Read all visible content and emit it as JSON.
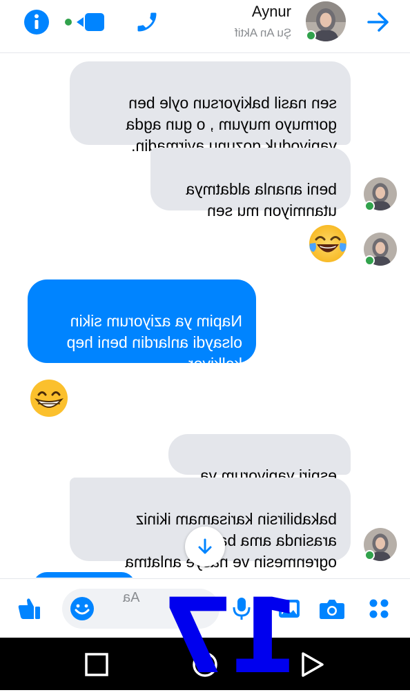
{
  "header": {
    "contact_name": "Aynur",
    "status": "Şu An Aktif",
    "icons": [
      "back-arrow-icon",
      "phone-icon",
      "video-call-icon",
      "info-icon"
    ]
  },
  "messages": [
    {
      "from": "contact",
      "text": "sen nasil bakiyorsun oyle ben\ngormuyo muyum , o gun agda\nyapiyoduk gozunu ayirmadin."
    },
    {
      "from": "contact",
      "text": "beni ananla aldatmya\nutanmiyon mu sen"
    },
    {
      "from": "contact",
      "emoji": "tears-of-joy-emoji"
    },
    {
      "from": "me",
      "text": "Napim ya aziyorum sikin\nolsaydi anlardin beni hep\nkalkiyor"
    },
    {
      "from": "me",
      "emoji": "grinning-emoji"
    },
    {
      "from": "contact",
      "text": "espiri yapiyorum ya"
    },
    {
      "from": "contact",
      "text": "bakabilirsin karisamam ikiniz\narasinda ama baban\nogrenmesin ve nasye anlatma"
    }
  ],
  "composer": {
    "placeholder": "Aa",
    "icons": [
      "apps-icon",
      "camera-icon",
      "gallery-icon",
      "microphone-icon",
      "emoji-icon",
      "like-icon"
    ]
  },
  "scroll_button": {
    "icon": "arrow-down-icon"
  },
  "nav": {
    "icons": [
      "back-nav-icon",
      "home-nav-icon",
      "recents-nav-icon"
    ]
  },
  "overlay_number": "17",
  "colors": {
    "accent": "#0084ff",
    "incoming_bubble": "#e4e6eb",
    "online": "#31a24c",
    "overlay": "#0000ee"
  }
}
